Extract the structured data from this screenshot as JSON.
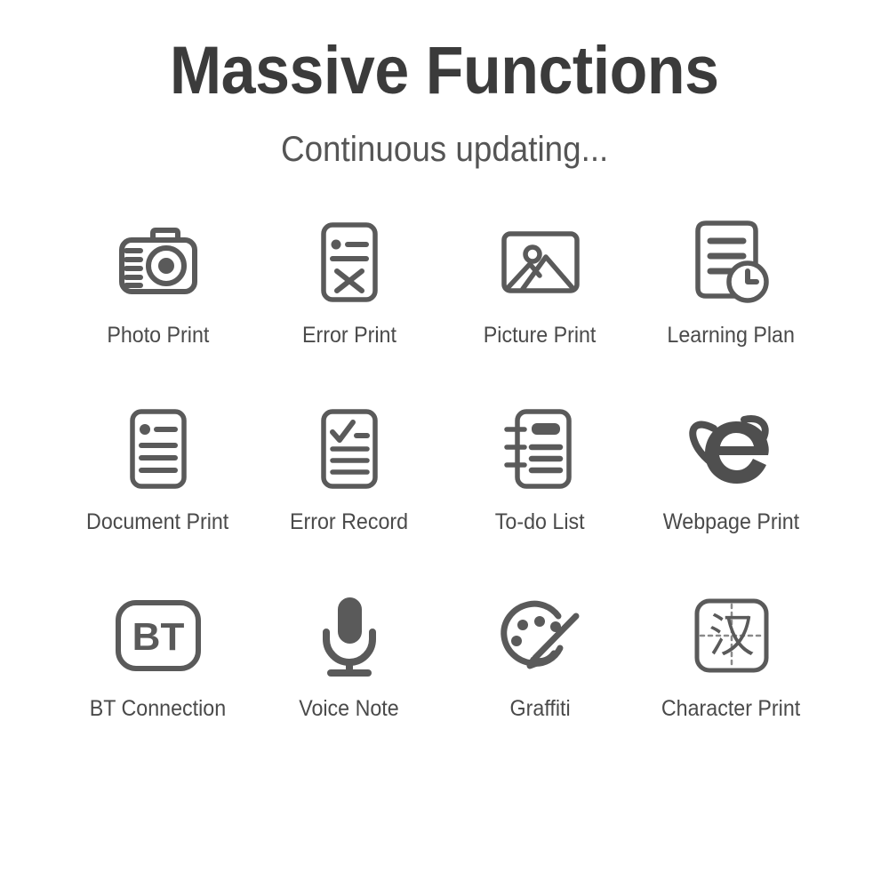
{
  "header": {
    "title": "Massive Functions",
    "subtitle": "Continuous updating..."
  },
  "colors": {
    "title": "#3b3b3b",
    "subtitle": "#555555",
    "label": "#4a4a4a",
    "icon_stroke": "#5a5a5a",
    "background": "#ffffff"
  },
  "features": {
    "rows": [
      [
        {
          "label": "Photo Print",
          "icon": "camera-icon"
        },
        {
          "label": "Error Print",
          "icon": "document-error-icon"
        },
        {
          "label": "Picture Print",
          "icon": "image-picture-icon"
        },
        {
          "label": "Learning Plan",
          "icon": "document-clock-icon"
        }
      ],
      [
        {
          "label": "Document Print",
          "icon": "document-lines-icon"
        },
        {
          "label": "Error Record",
          "icon": "document-check-icon"
        },
        {
          "label": "To-do List",
          "icon": "notebook-icon"
        },
        {
          "label": "Webpage Print",
          "icon": "internet-explorer-icon"
        }
      ],
      [
        {
          "label": "BT Connection",
          "icon": "bluetooth-bt-icon",
          "glyph": "BT"
        },
        {
          "label": "Voice Note",
          "icon": "microphone-icon"
        },
        {
          "label": "Graffiti",
          "icon": "palette-brush-icon"
        },
        {
          "label": "Character Print",
          "icon": "chinese-character-icon",
          "glyph": "汉"
        }
      ]
    ]
  }
}
